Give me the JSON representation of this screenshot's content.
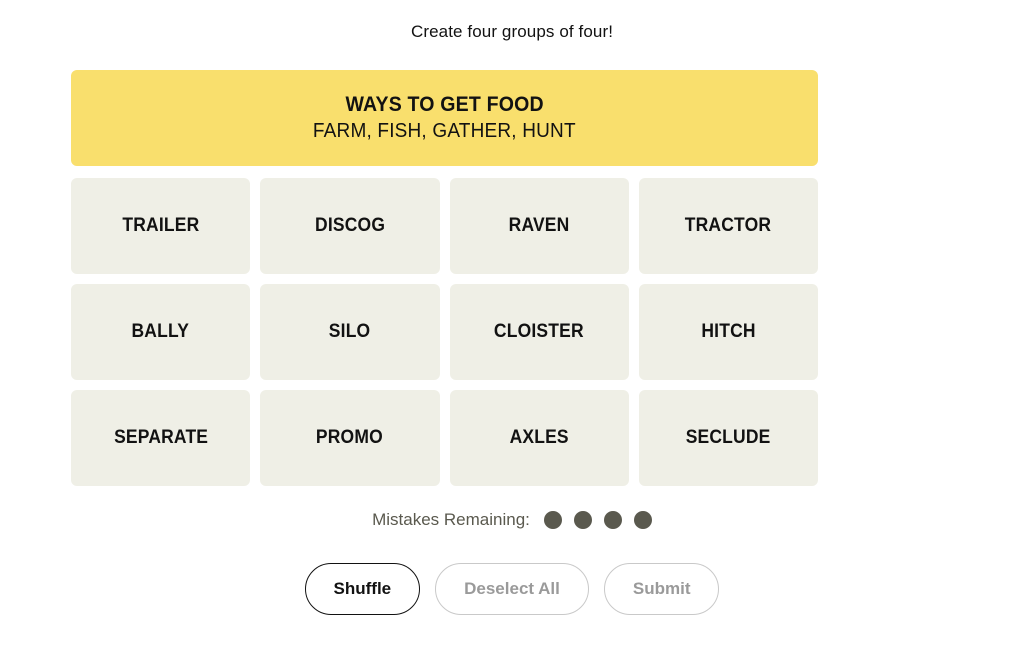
{
  "instruction": "Create four groups of four!",
  "solved_groups": [
    {
      "category": "WAYS TO GET FOOD",
      "words_line": "FARM, FISH, GATHER, HUNT",
      "color": "#F9DF6D",
      "words": [
        "FARM",
        "FISH",
        "GATHER",
        "HUNT"
      ]
    }
  ],
  "tiles": [
    {
      "label": "TRAILER"
    },
    {
      "label": "DISCOG"
    },
    {
      "label": "RAVEN"
    },
    {
      "label": "TRACTOR"
    },
    {
      "label": "BALLY"
    },
    {
      "label": "SILO"
    },
    {
      "label": "CLOISTER"
    },
    {
      "label": "HITCH"
    },
    {
      "label": "SEPARATE"
    },
    {
      "label": "PROMO"
    },
    {
      "label": "AXLES"
    },
    {
      "label": "SECLUDE"
    }
  ],
  "tile_color": "#EFEFE6",
  "mistakes": {
    "label": "Mistakes Remaining:",
    "remaining": 4,
    "dot_color": "#5A594E"
  },
  "buttons": {
    "shuffle": {
      "label": "Shuffle",
      "state": "enabled"
    },
    "deselect": {
      "label": "Deselect All",
      "state": "disabled"
    },
    "submit": {
      "label": "Submit",
      "state": "disabled"
    }
  }
}
